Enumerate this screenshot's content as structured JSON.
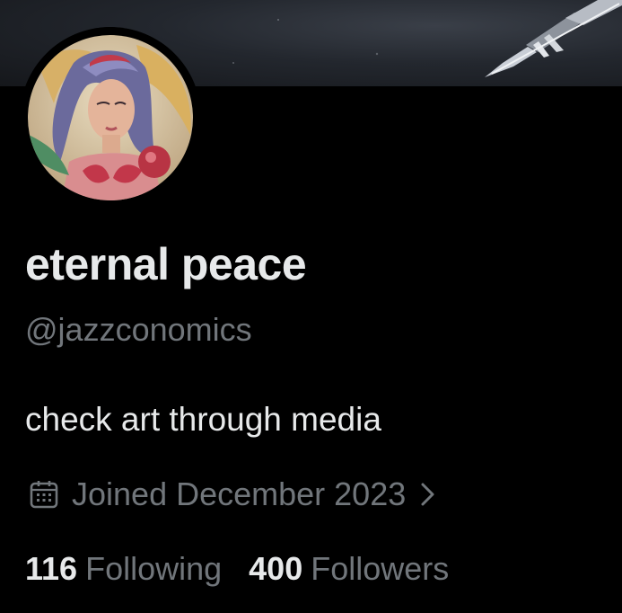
{
  "profile": {
    "display_name": "eternal peace",
    "handle": "@jazzconomics",
    "bio": "check art through media",
    "joined": "Joined December 2023"
  },
  "stats": {
    "following_count": "116",
    "following_label": "Following",
    "followers_count": "400",
    "followers_label": "Followers"
  },
  "icons": {
    "joined": "calendar-icon",
    "joined_more": "chevron-right-icon"
  },
  "colors": {
    "background": "#000000",
    "primary_text": "#e7e9ea",
    "secondary_text": "#71767b"
  }
}
